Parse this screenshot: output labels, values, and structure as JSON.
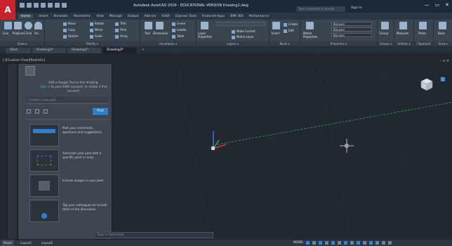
{
  "app": {
    "logo": "A",
    "title": "Autodesk AutoCAD 2016 - EDUCATIONAL VERSION    Drawing1.dwg",
    "search_placeholder": "Type a keyword or phrase",
    "signin": "Sign In"
  },
  "window_controls": [
    "—",
    "▭",
    "✕"
  ],
  "ribbon_tabs": [
    "Home",
    "Insert",
    "Annotate",
    "Parametric",
    "View",
    "Manage",
    "Output",
    "Add-ins",
    "A360",
    "Express Tools",
    "Featured Apps",
    "BIM 360",
    "Performance"
  ],
  "ribbon": {
    "draw": {
      "title": "Draw ▾",
      "buttons": [
        "Line",
        "Polyline",
        "Circle",
        "Arc"
      ]
    },
    "modify": {
      "title": "Modify ▾",
      "buttons": [
        "Move",
        "Rotate",
        "Trim",
        "Copy",
        "Mirror",
        "Fillet",
        "Stretch",
        "Scale",
        "Array"
      ]
    },
    "annotation": {
      "title": "Annotation ▾",
      "buttons": [
        "Text",
        "Dimension",
        "Linear",
        "Leader",
        "Table"
      ]
    },
    "layers": {
      "title": "Layers ▾",
      "buttons": [
        "Layer Properties",
        "Make Current",
        "Match Layer"
      ]
    },
    "block": {
      "title": "Block ▾",
      "buttons": [
        "Insert",
        "Create",
        "Edit"
      ]
    },
    "properties": {
      "title": "Properties ▾",
      "buttons": [
        "Match Properties"
      ],
      "combos": [
        "ByLayer",
        "ByLayer",
        "ByLayer"
      ]
    },
    "groups": {
      "title": "Groups ▾",
      "buttons": [
        "Group"
      ]
    },
    "utilities": {
      "title": "Utilities ▾",
      "buttons": [
        "Measure"
      ]
    },
    "clipboard": {
      "title": "Clipboard",
      "buttons": [
        "Paste"
      ]
    },
    "view": {
      "title": "View ▾",
      "buttons": [
        "Base"
      ]
    }
  },
  "doc_tabs": [
    "Start",
    "Drawing1*",
    "Drawing2*",
    "Drawing3*",
    "+"
  ],
  "viewport": {
    "label": "[-][Custom View][Realistic]",
    "controls": "– ▫ ×"
  },
  "feed": {
    "message_prefix": "Add a Google Tool to this drawing.",
    "message_link": "Sign in",
    "message_suffix": "to your A360 account, or create a free account.",
    "input_placeholder": "Create a new post...",
    "post_button": "Post",
    "tips": [
      {
        "text": "Post your comments, questions and suggestions."
      },
      {
        "text": "Associate your post with a specific point or area."
      },
      {
        "text": "Include images in your post."
      },
      {
        "text": "Tag your colleagues to include them in the discussion."
      }
    ]
  },
  "command_line": {
    "placeholder": "Type a command"
  },
  "layout_tabs": [
    "Model",
    "Layout1",
    "Layout2"
  ],
  "status": {
    "mode": "MODEL"
  },
  "colors": {
    "background": "#212830",
    "accent": "#2d7fd2",
    "app_red": "#c8232c",
    "axis_x": "#d23b3b",
    "axis_y": "#3fae4f",
    "axis_z": "#3a78d8"
  }
}
